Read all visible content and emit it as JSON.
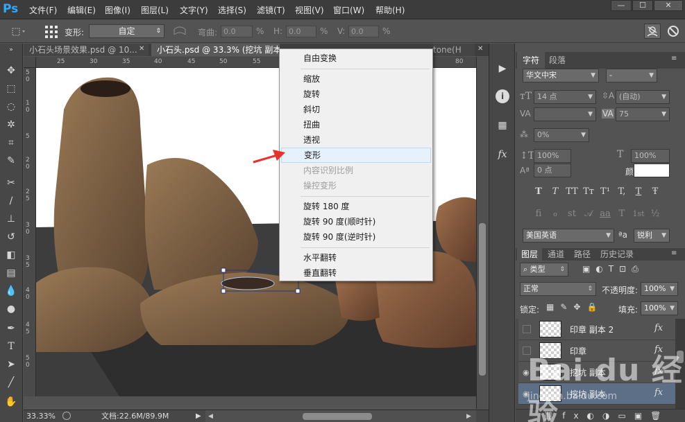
{
  "app": {
    "logo": "Ps"
  },
  "menubar": {
    "items": [
      "文件(F)",
      "编辑(E)",
      "图像(I)",
      "图层(L)",
      "文字(Y)",
      "选择(S)",
      "滤镜(T)",
      "视图(V)",
      "窗口(W)",
      "帮助(H)"
    ],
    "window_buttons": [
      "—",
      "☐",
      "✕"
    ]
  },
  "options": {
    "transform_label": "变形:",
    "transform_value": "自定",
    "bend_label": "弯曲:",
    "bend_value": "0.0",
    "h_label": "H:",
    "h_value": "0.0",
    "v_label": "V:",
    "v_value": "0.0",
    "percent": "%"
  },
  "tabs": [
    {
      "label": "小石头场景效果.psd @ 10...",
      "close": "✕",
      "active": false
    },
    {
      "label": "小石头.psd @ 33.3% (挖坑 副本",
      "close": "",
      "active": true
    },
    {
      "label": "tone(H",
      "close": "✕",
      "active": false
    }
  ],
  "ruler": {
    "top": [
      "25",
      "30",
      "35",
      "40",
      "45",
      "50",
      "55",
      "80"
    ],
    "left": [
      "5",
      "0",
      "1",
      "0",
      "5",
      "2",
      "0",
      "2",
      "5",
      "3",
      "0",
      "3",
      "5",
      "4",
      "0",
      "4",
      "5",
      "5",
      "0"
    ]
  },
  "statusbar": {
    "zoom": "33.33%",
    "doc": "文档:22.6M/89.9M"
  },
  "character_panel": {
    "tabs": [
      "字符",
      "段落"
    ],
    "font_family": "华文中宋",
    "font_style": "-",
    "size": "14 点",
    "leading": "(自动)",
    "kerning": "",
    "tracking": "75",
    "scale_pct": "0%",
    "vscale": "100%",
    "hscale": "100%",
    "baseline": "0 点",
    "color_label": "颜色:",
    "glyphs_row1": [
      "T",
      "T",
      "TT",
      "Tт",
      "T¹",
      "T,",
      "T",
      "Ŧ"
    ],
    "glyphs_row2": [
      "fi",
      "ℴ",
      "st",
      "𝒜",
      "aa",
      "T",
      "1st",
      "½"
    ],
    "language": "美国英语",
    "aa_icon": "ªa",
    "antialias": "锐利"
  },
  "layers_panel": {
    "tabs": [
      "图层",
      "通道",
      "路径",
      "历史记录"
    ],
    "filter_label": "类型",
    "blend_mode": "正常",
    "opacity_label": "不透明度:",
    "opacity": "100%",
    "lock_label": "锁定:",
    "fill_label": "填充:",
    "fill": "100%",
    "layers": [
      {
        "name": "印章 副本 2",
        "fx": "fx"
      },
      {
        "name": "印章",
        "fx": "fx"
      },
      {
        "name": "挖坑 副本",
        "fx": "fx"
      },
      {
        "name": "挖坑 副本",
        "fx": "fx"
      }
    ]
  },
  "context_menu": {
    "items": [
      {
        "label": "自由变换",
        "state": "normal"
      },
      {
        "label": "缩放",
        "state": "normal"
      },
      {
        "label": "旋转",
        "state": "normal"
      },
      {
        "label": "斜切",
        "state": "normal"
      },
      {
        "label": "扭曲",
        "state": "normal"
      },
      {
        "label": "透视",
        "state": "normal"
      },
      {
        "label": "变形",
        "state": "hover"
      },
      {
        "label": "内容识别比例",
        "state": "disabled"
      },
      {
        "label": "操控变形",
        "state": "disabled"
      },
      {
        "label": "旋转 180 度",
        "state": "normal"
      },
      {
        "label": "旋转 90 度(顺时针)",
        "state": "normal"
      },
      {
        "label": "旋转 90 度(逆时针)",
        "state": "normal"
      },
      {
        "label": "水平翻转",
        "state": "normal"
      },
      {
        "label": "垂直翻转",
        "state": "normal"
      }
    ]
  },
  "watermark": {
    "brand": "Bai du 经验",
    "url": "jingyan.baidu.com"
  },
  "colors": {
    "accent": "#31a8ff",
    "arrow": "#e8312a",
    "menu_hover": "#e5f1fb"
  }
}
